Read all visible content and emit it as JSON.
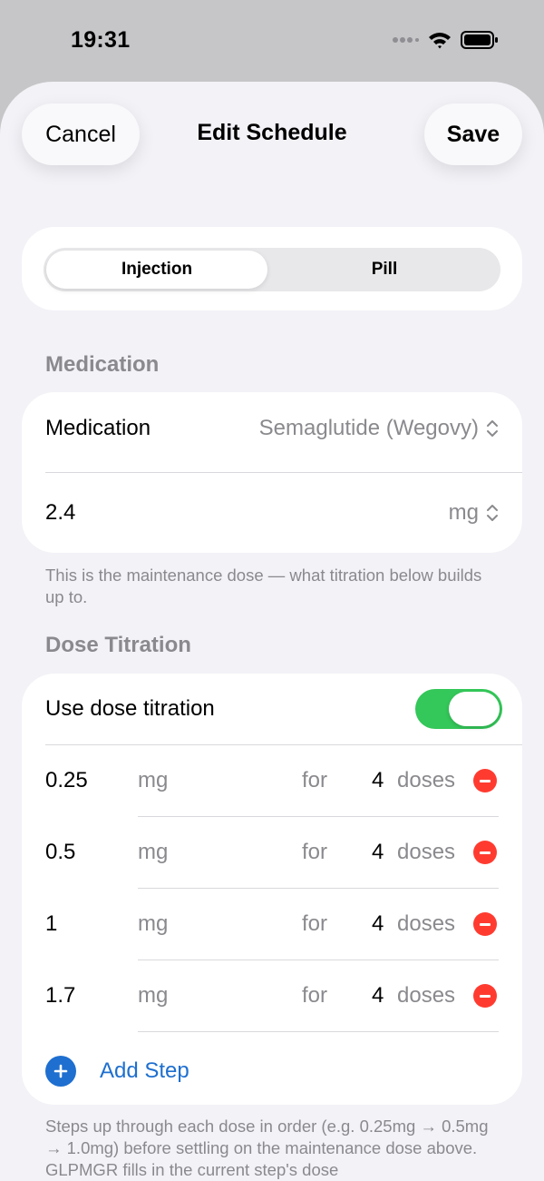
{
  "status_bar": {
    "time": "19:31"
  },
  "nav": {
    "cancel_label": "Cancel",
    "title": "Edit Schedule",
    "save_label": "Save"
  },
  "type_picker": {
    "options": [
      "Injection",
      "Pill"
    ],
    "selected": "Injection"
  },
  "medication_section": {
    "header": "Medication",
    "medication_label": "Medication",
    "medication_value": "Semaglutide (Wegovy)",
    "dose_value": "2.4",
    "dose_unit": "mg",
    "footnote": "This is the maintenance dose — what titration below builds up to."
  },
  "titration_section": {
    "header": "Dose Titration",
    "toggle_label": "Use dose titration",
    "toggle_on": true,
    "steps": [
      {
        "dose": "0.25",
        "unit": "mg",
        "for": "for",
        "count": "4",
        "doses_label": "doses"
      },
      {
        "dose": "0.5",
        "unit": "mg",
        "for": "for",
        "count": "4",
        "doses_label": "doses"
      },
      {
        "dose": "1",
        "unit": "mg",
        "for": "for",
        "count": "4",
        "doses_label": "doses"
      },
      {
        "dose": "1.7",
        "unit": "mg",
        "for": "for",
        "count": "4",
        "doses_label": "doses"
      }
    ],
    "add_step_label": "Add Step",
    "footnote": "Steps up through each dose in order (e.g. 0.25mg → 0.5mg → 1.0mg) before settling on the maintenance dose above. GLPMGR fills in the current step's dose"
  },
  "colors": {
    "accent": "#1e6fcf",
    "toggle_on": "#34c759",
    "destructive": "#ff3b30",
    "secondary_text": "#8a8a8e"
  },
  "icons": [
    "signal-icon",
    "wifi-icon",
    "battery-icon",
    "chevron-updown-icon",
    "minus-circle-icon",
    "plus-circle-icon"
  ]
}
